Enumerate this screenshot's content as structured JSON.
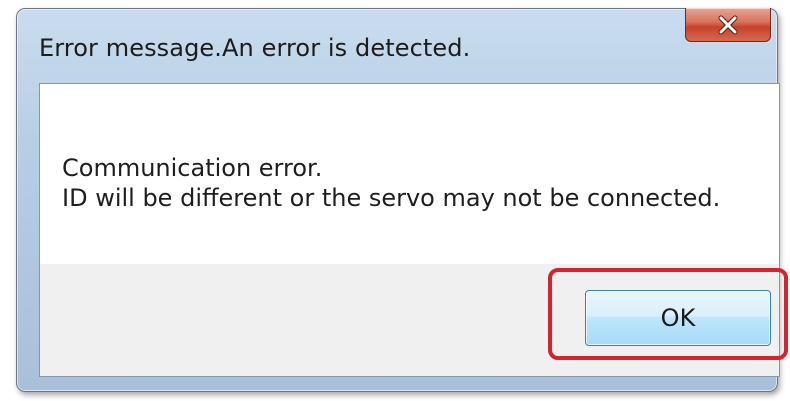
{
  "dialog": {
    "title": "Error message.An error is detected.",
    "close_icon": "close-icon",
    "message_lines": [
      "Communication error.",
      "ID will be different or the servo may not be connected."
    ],
    "ok_label": "OK"
  },
  "colors": {
    "highlight_outline": "#d4242e",
    "close_button": "#c6412a",
    "ok_button": "#bee6fd"
  }
}
